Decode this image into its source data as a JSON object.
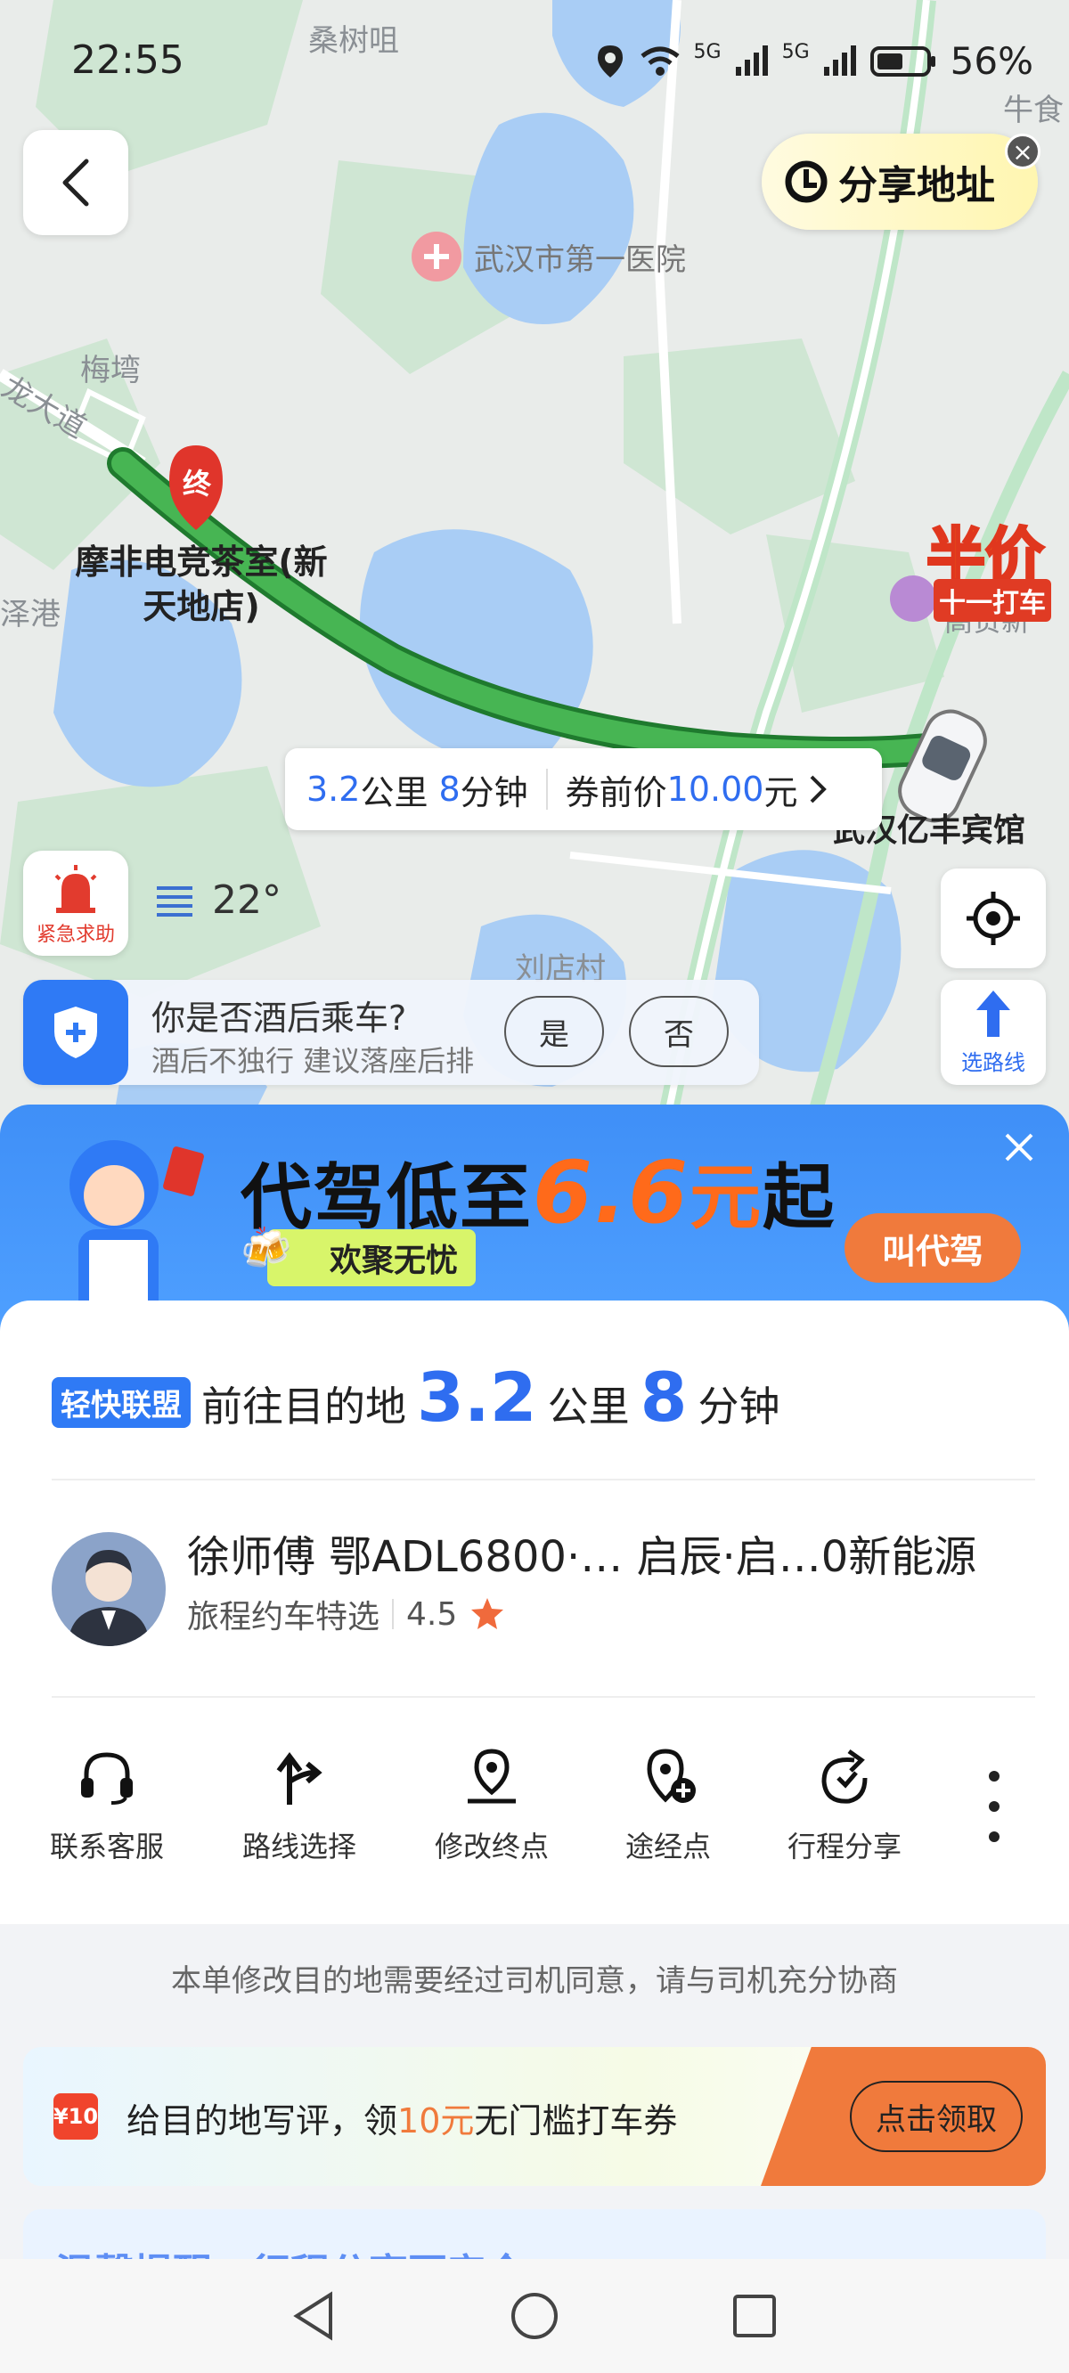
{
  "status_bar": {
    "time": "22:55",
    "battery": "56%",
    "network1": "5G",
    "network2": "5G"
  },
  "map": {
    "labels": {
      "sangshu": "桑树咀",
      "hospital": "武汉市第一医院",
      "meiwan": "梅塆",
      "road": "龙大道",
      "gang": "泽港",
      "liudian": "刘店村",
      "niu": "牛食",
      "hotel": "武汉亿丰宾馆",
      "hotel_partial": "高贤新"
    },
    "destination_marker": "终",
    "destination_name_line1": "摩非电竞茶室(新",
    "destination_name_line2": "天地店)",
    "share_address_label": "分享地址",
    "half_price": {
      "big": "半价",
      "small": "十一打车"
    },
    "route_info": {
      "distance_value": "3.2",
      "distance_unit": "公里",
      "time_value": "8",
      "time_unit": "分钟",
      "price_label": "券前价",
      "price_value": "10.00",
      "price_unit": "元"
    },
    "sos_label": "紧急求助",
    "weather_temp": "22°",
    "route_select_label": "选路线",
    "drunk_prompt": {
      "question": "你是否酒后乘车?",
      "subtitle": "酒后不独行 建议落座后排",
      "yes": "是",
      "no": "否"
    }
  },
  "promo": {
    "title_prefix": "代驾低至",
    "title_number": "6.6",
    "title_suffix": "元起",
    "tag": "欢聚无忧",
    "cta": "叫代驾"
  },
  "trip": {
    "badge": "轻快联盟",
    "prefix": "前往目的地",
    "distance": "3.2",
    "distance_unit": "公里",
    "minutes": "8",
    "minutes_unit": "分钟"
  },
  "driver": {
    "name_line": "徐师傅  鄂ADL6800·…  启辰·启…0新能源",
    "service": "旅程约车特选",
    "rating": "4.5"
  },
  "actions": [
    {
      "label": "联系客服",
      "icon": "headset-icon"
    },
    {
      "label": "路线选择",
      "icon": "route-icon"
    },
    {
      "label": "修改终点",
      "icon": "pin-icon"
    },
    {
      "label": "途经点",
      "icon": "waypoint-icon"
    },
    {
      "label": "行程分享",
      "icon": "share-icon"
    }
  ],
  "notice": "本单修改目的地需要经过司机同意，请与司机充分协商",
  "review_banner": {
    "coupon": "¥10",
    "text_before": "给目的地写评，领",
    "highlight": "10元",
    "text_after": "无门槛打车券",
    "button": "点击领取"
  },
  "peek_text": "温馨提醒…行程分享更安全",
  "colors": {
    "accent": "#2f6df0",
    "route": "#3aa64a",
    "orange": "#f07a3c"
  }
}
